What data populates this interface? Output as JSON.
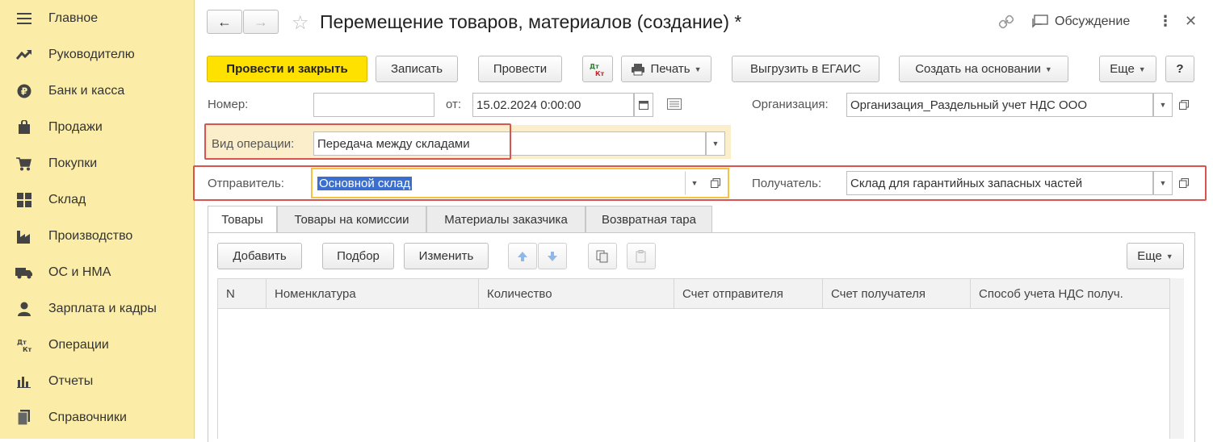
{
  "sidebar": {
    "items": [
      {
        "label": "Главное",
        "icon": "menu-icon"
      },
      {
        "label": "Руководителю",
        "icon": "trend-icon"
      },
      {
        "label": "Банк и касса",
        "icon": "ruble-coin-icon"
      },
      {
        "label": "Продажи",
        "icon": "shopping-bag-icon"
      },
      {
        "label": "Покупки",
        "icon": "cart-icon"
      },
      {
        "label": "Склад",
        "icon": "warehouse-grid-icon"
      },
      {
        "label": "Производство",
        "icon": "factory-icon"
      },
      {
        "label": "ОС и НМА",
        "icon": "truck-icon"
      },
      {
        "label": "Зарплата и кадры",
        "icon": "person-icon"
      },
      {
        "label": "Операции",
        "icon": "dt-kt-icon"
      },
      {
        "label": "Отчеты",
        "icon": "bar-chart-icon"
      },
      {
        "label": "Справочники",
        "icon": "books-icon"
      }
    ]
  },
  "header": {
    "title": "Перемещение товаров, материалов (создание) *",
    "discussion": "Обсуждение",
    "more_icon": "⋮",
    "close_icon": "✕"
  },
  "toolbar": {
    "post_close": "Провести и закрыть",
    "save": "Записать",
    "post": "Провести",
    "dtkt_top": "Дт",
    "dtkt_bottom": "Кт",
    "print": "Печать",
    "egais": "Выгрузить в ЕГАИС",
    "create_based": "Создать на основании",
    "more": "Еще",
    "help": "?"
  },
  "form": {
    "number_label": "Номер:",
    "number_value": "",
    "date_label": "от:",
    "date_value": "15.02.2024  0:00:00",
    "org_label": "Организация:",
    "org_value": "Организация_Раздельный учет НДС ООО",
    "op_label": "Вид операции:",
    "op_value": "Передача между складами",
    "sender_label": "Отправитель:",
    "sender_value": "Основной склад",
    "receiver_label": "Получатель:",
    "receiver_value": "Склад для гарантийных запасных частей"
  },
  "tabs": [
    {
      "label": "Товары",
      "active": true
    },
    {
      "label": "Товары на комиссии",
      "active": false
    },
    {
      "label": "Материалы заказчика",
      "active": false
    },
    {
      "label": "Возвратная тара",
      "active": false
    }
  ],
  "table_toolbar": {
    "add": "Добавить",
    "select": "Подбор",
    "edit": "Изменить",
    "more": "Еще"
  },
  "table": {
    "columns": [
      "N",
      "Номенклатура",
      "Количество",
      "Счет отправителя",
      "Счет получателя",
      "Способ учета НДС получ."
    ],
    "rows": []
  },
  "colors": {
    "sidebar_bg": "#fbeda7",
    "primary_button": "#ffe100",
    "highlight_box": "#d9534f",
    "active_field_border": "#f5c242",
    "selection": "#3b6fcf"
  }
}
